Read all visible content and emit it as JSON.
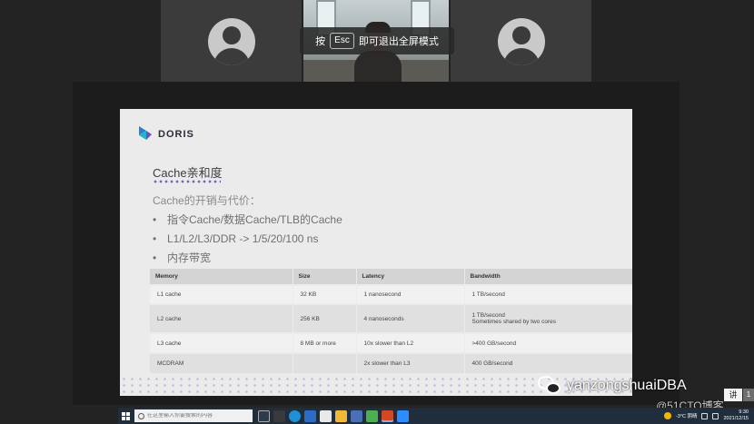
{
  "overlay": {
    "prefix": "按",
    "key": "Esc",
    "suffix": "即可退出全屏模式"
  },
  "participants": [
    {
      "avatar": "person-silhouette-icon"
    },
    {
      "video": "camera-feed"
    },
    {
      "avatar": "person-silhouette-icon"
    }
  ],
  "slide": {
    "logo_text": "DORIS",
    "title": "Cache亲和度",
    "intro": "Cache的开销与代价：",
    "bullets": [
      "指令Cache/数据Cache/TLB的Cache",
      "L1/L2/L3/DDR -> 1/5/20/100 ns",
      "内存带宽"
    ],
    "table": {
      "headers": [
        "Memory",
        "Size",
        "Latency",
        "Bandwidth"
      ],
      "rows": [
        {
          "memory": "L1 cache",
          "size": "32 KB",
          "latency": "1 nanosecond",
          "bandwidth": "1 TB/second",
          "note": ""
        },
        {
          "memory": "L2 cache",
          "size": "256 KB",
          "latency": "4 nanoseconds",
          "bandwidth": "1 TB/second",
          "note": "Sometimes shared by two cores"
        },
        {
          "memory": "L3 cache",
          "size": "8 MB or more",
          "latency": "10x slower than L2",
          "bandwidth": ">400 GB/second",
          "note": ""
        },
        {
          "memory": "MCDRAM",
          "size": "",
          "latency": "2x slower than L3",
          "bandwidth": "400 GB/second",
          "note": ""
        }
      ]
    }
  },
  "watermark": {
    "account": "yanzongshuaiDBA",
    "site": "@51CTO博客"
  },
  "badges": {
    "ime": "讲",
    "side": "1"
  },
  "taskbar": {
    "search_placeholder": "在这里输入你要搜索的内容",
    "weather": "-3°C 阴晴",
    "time": "9:30",
    "date": "2021/12/15"
  },
  "colors": {
    "slide_bg": "#ebebeb",
    "accent": "#7a63b8",
    "taskbar": "#1f2d3d"
  }
}
